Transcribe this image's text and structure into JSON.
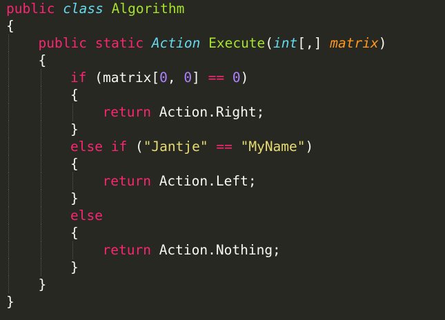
{
  "code": {
    "lines": [
      {
        "indent": 0,
        "tokens": [
          {
            "t": "public",
            "c": "kw"
          },
          {
            "t": " ",
            "c": "plain"
          },
          {
            "t": "class",
            "c": "type"
          },
          {
            "t": " ",
            "c": "plain"
          },
          {
            "t": "Algorithm",
            "c": "fn"
          }
        ]
      },
      {
        "indent": 0,
        "tokens": [
          {
            "t": "{",
            "c": "plain"
          }
        ]
      },
      {
        "indent": 1,
        "tokens": [
          {
            "t": "public",
            "c": "kw"
          },
          {
            "t": " ",
            "c": "plain"
          },
          {
            "t": "static",
            "c": "kw"
          },
          {
            "t": " ",
            "c": "plain"
          },
          {
            "t": "Action",
            "c": "type"
          },
          {
            "t": " ",
            "c": "plain"
          },
          {
            "t": "Execute",
            "c": "fn"
          },
          {
            "t": "(",
            "c": "plain"
          },
          {
            "t": "int",
            "c": "type"
          },
          {
            "t": "[,] ",
            "c": "plain"
          },
          {
            "t": "matrix",
            "c": "param"
          },
          {
            "t": ")",
            "c": "plain"
          }
        ]
      },
      {
        "indent": 1,
        "tokens": [
          {
            "t": "{",
            "c": "plain"
          }
        ]
      },
      {
        "indent": 2,
        "tokens": [
          {
            "t": "if",
            "c": "kw"
          },
          {
            "t": " (matrix[",
            "c": "plain"
          },
          {
            "t": "0",
            "c": "num"
          },
          {
            "t": ", ",
            "c": "plain"
          },
          {
            "t": "0",
            "c": "num"
          },
          {
            "t": "] ",
            "c": "plain"
          },
          {
            "t": "==",
            "c": "kw"
          },
          {
            "t": " ",
            "c": "plain"
          },
          {
            "t": "0",
            "c": "num"
          },
          {
            "t": ")",
            "c": "plain"
          }
        ]
      },
      {
        "indent": 2,
        "tokens": [
          {
            "t": "{",
            "c": "plain"
          }
        ]
      },
      {
        "indent": 3,
        "tokens": [
          {
            "t": "return",
            "c": "kw"
          },
          {
            "t": " Action.Right;",
            "c": "plain"
          }
        ]
      },
      {
        "indent": 2,
        "tokens": [
          {
            "t": "}",
            "c": "plain"
          }
        ]
      },
      {
        "indent": 2,
        "tokens": [
          {
            "t": "else",
            "c": "kw"
          },
          {
            "t": " ",
            "c": "plain"
          },
          {
            "t": "if",
            "c": "kw"
          },
          {
            "t": " (",
            "c": "plain"
          },
          {
            "t": "\"Jantje\"",
            "c": "str"
          },
          {
            "t": " ",
            "c": "plain"
          },
          {
            "t": "==",
            "c": "kw"
          },
          {
            "t": " ",
            "c": "plain"
          },
          {
            "t": "\"MyName\"",
            "c": "str"
          },
          {
            "t": ")",
            "c": "plain"
          }
        ]
      },
      {
        "indent": 2,
        "tokens": [
          {
            "t": "{",
            "c": "plain"
          }
        ]
      },
      {
        "indent": 3,
        "tokens": [
          {
            "t": "return",
            "c": "kw"
          },
          {
            "t": " Action.Left;",
            "c": "plain"
          }
        ]
      },
      {
        "indent": 2,
        "tokens": [
          {
            "t": "}",
            "c": "plain"
          }
        ]
      },
      {
        "indent": 2,
        "tokens": [
          {
            "t": "else",
            "c": "kw"
          }
        ]
      },
      {
        "indent": 2,
        "tokens": [
          {
            "t": "{",
            "c": "plain"
          }
        ]
      },
      {
        "indent": 3,
        "tokens": [
          {
            "t": "return",
            "c": "kw"
          },
          {
            "t": " Action.Nothing;",
            "c": "plain"
          }
        ]
      },
      {
        "indent": 2,
        "tokens": [
          {
            "t": "}",
            "c": "plain"
          }
        ]
      },
      {
        "indent": 1,
        "tokens": [
          {
            "t": "}",
            "c": "plain"
          }
        ]
      },
      {
        "indent": 0,
        "tokens": [
          {
            "t": "}",
            "c": "plain"
          }
        ]
      }
    ]
  },
  "colors": {
    "background": "#272822",
    "keyword": "#F92672",
    "type": "#66D9EF",
    "function": "#A6E22E",
    "parameter": "#FD971F",
    "number": "#AE81FF",
    "string": "#E6DB74",
    "text": "#F8F8F2"
  }
}
